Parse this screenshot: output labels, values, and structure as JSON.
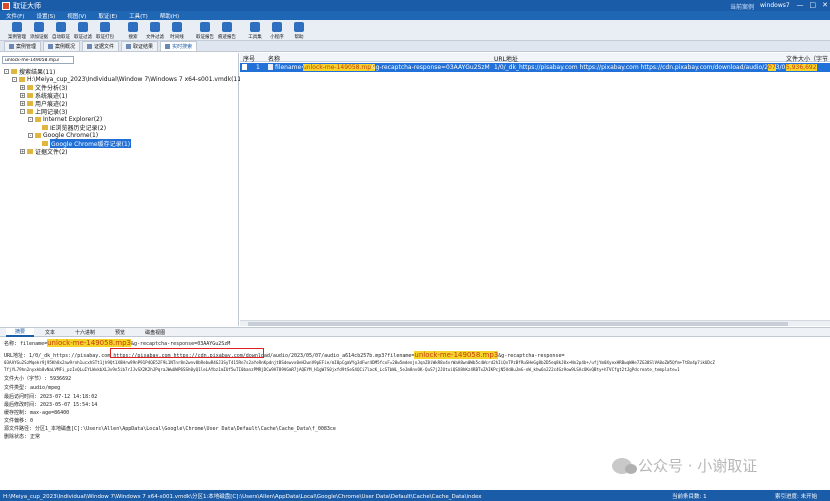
{
  "window": {
    "title": "取证大师",
    "user_label": "当前案例",
    "user": "windows7",
    "btn_min": "—",
    "btn_max": "□",
    "btn_close": "✕"
  },
  "menu": [
    "文件(F)",
    "设置(S)",
    "视图(V)",
    "取证(E)",
    "工具(T)",
    "帮助(H)"
  ],
  "toolbar": [
    {
      "label": "案例管理",
      "icon": "folder-icon"
    },
    {
      "label": "添加证据",
      "icon": "add-icon"
    },
    {
      "label": "自动取证",
      "icon": "auto-icon"
    },
    {
      "label": "取证过滤",
      "icon": "filter-icon"
    },
    {
      "label": "取证打包",
      "icon": "package-icon"
    },
    {
      "label": "搜索",
      "icon": "search-icon"
    },
    {
      "label": "文件过滤",
      "icon": "file-filter-icon"
    },
    {
      "label": "时间线",
      "icon": "timeline-icon"
    },
    {
      "label": "取证报告",
      "icon": "report-icon"
    },
    {
      "label": "痕迹报告",
      "icon": "trace-report-icon"
    },
    {
      "label": "工具集",
      "icon": "tools-icon"
    },
    {
      "label": "小程序",
      "icon": "applet-icon"
    },
    {
      "label": "帮助",
      "icon": "help-icon"
    }
  ],
  "tabs": [
    {
      "label": "案例管理",
      "active": false
    },
    {
      "label": "案例概况",
      "active": false
    },
    {
      "label": "证据文件",
      "active": false
    },
    {
      "label": "取证结果",
      "active": false
    },
    {
      "label": "实时搜索",
      "active": true
    }
  ],
  "search": {
    "value": "unlock-me-149058.mp3"
  },
  "tree": [
    {
      "label": "搜索结果(11)",
      "depth": 0,
      "expanded": true
    },
    {
      "label": "H:\\Meiya_cup_2023\\Individual\\Window 7\\Windows 7 x64-s001.vmdk(11)",
      "depth": 1,
      "expanded": true
    },
    {
      "label": "文件分析(3)",
      "depth": 2,
      "expanded": false
    },
    {
      "label": "系统痕迹(1)",
      "depth": 2,
      "expanded": false
    },
    {
      "label": "用户痕迹(2)",
      "depth": 2,
      "expanded": false
    },
    {
      "label": "上网记录(3)",
      "depth": 2,
      "expanded": true
    },
    {
      "label": "Internet Explorer(2)",
      "depth": 3,
      "expanded": true
    },
    {
      "label": "IE浏览器历史记录(2)",
      "depth": 4,
      "expanded": false
    },
    {
      "label": "Google Chrome(1)",
      "depth": 3,
      "expanded": true
    },
    {
      "label": "Google Chrome缓存记录(1)",
      "depth": 4,
      "expanded": false,
      "selected": true
    },
    {
      "label": "证据文件(2)",
      "depth": 2,
      "expanded": false
    }
  ],
  "grid": {
    "headers": {
      "no": "序号",
      "name": "名称",
      "url": "URL地址",
      "size": "文件大小（字节"
    },
    "row": {
      "no": "1",
      "name_prefix": "filename=",
      "name_hl": "unlock-me-149058.mp3",
      "name_suffix": "&g-recaptcha-response=03AAYGu2SzM",
      "url_text": "1/0/_dk_https://pisabay.com https://pixabay.com https://cdn.pixabay.com/download/audio/2023/05/",
      "url_hl": "07",
      "size": "5,936,692"
    }
  },
  "detail_tabs": [
    {
      "label": "摘要",
      "active": true
    },
    {
      "label": "文本",
      "active": false
    },
    {
      "label": "十六进制",
      "active": false
    },
    {
      "label": "预览",
      "active": false
    },
    {
      "label": "磁盘视图",
      "active": false
    }
  ],
  "detail": {
    "name_prefix": "名称: filename=",
    "name_hl": "unlock-me-149058.mp3",
    "name_suffix": "&g-recaptcha-response=03AAYGu2SzM",
    "url_a": "URL地址: 1/0/_dk_https://pisabay.com ",
    "url_box": "https://pixabay.com https://cdn.pixabay.com/download",
    "url_b": "/audio/2023/05/07/audio_a614cb257b.mp3?filename=",
    "url_hl": "unlock-me-149058.mp3",
    "url_c": "&g-recaptcha-response=",
    "hash1": "03AAYGu2SzMqekr9j95Kh8x2nw9rnh1ucxhSTt1jh9Qt1X8Hrw99nP91P4QE52F9L1NTnr8n2wnv8bRebwR4GJ3SyT415Rn7s2aYeRnKpdnjtBSdewvx0eH2wnV9pEFie/mI8pCgmVYg3dFwr4DM5fcxF=28w5mdenjnJqnZ8iWkR8x4vrWaA8wn0Wb5c4Wcrd2hIiQvTPzBfRuSHeGg8b2D5eq8kJ8x+Nn2p4b+/ufjYm0XyexHRBwqWHe7ZG38SlVA0oZW5Qfm+TtBx4p7ikUDcZ",
    "hash2": "TfjYL79hn2nyxkb8vNaLVMFi_pzIvQLuIYLWvkbXL3v9n5ib7rJJvSX2K2hJPqraJWwUWP6SSh0yQ1leLAYbz1mIUf5wTI0banzPMRjDCw9AT89VGmR7jAQEYM_H1gW7S0jxfd9tSeS4QCi7lacK_LcSTbWL_5eJm8nvOK-QuS7j2JOtuiQSX8hKz4RBTxZAIKPcjN5Vd8uJmG-nW_khw6n222c4Gz9ow9LSAcOKvQBty+hTVCfgt2tJgPdcreate_template=1",
    "lines": [
      "文件大小（字节）: 5936692",
      "文件类型: audio/mpeg",
      "最后访问时间: 2023-07-12 14:18:02",
      "最后修改时间: 2023-05-07 15:54:14",
      "缓存控制: max-age=86400",
      "文件偏移: 0",
      "源文件路径: 分区1_本地磁盘[C]:\\Users\\Allen\\AppData\\Local\\Google\\Chrome\\User Data\\Default\\Cache\\Cache_Data\\f_0083ce",
      "删除状态: 正常"
    ]
  },
  "watermark": {
    "text": "公众号 · 小谢取证"
  },
  "status": {
    "path": "H:\\Meiya_cup_2023\\Individual\\Window 7\\Windows 7 x64-s001.vmdk\\分区1:本地磁盘[C]:\\Users\\Allen\\AppData\\Local\\Google\\Chrome\\User Data\\Default\\Cache\\Cache_Data\\index",
    "records": "当前条目数: 1",
    "index": "索引进度: 未开始"
  }
}
